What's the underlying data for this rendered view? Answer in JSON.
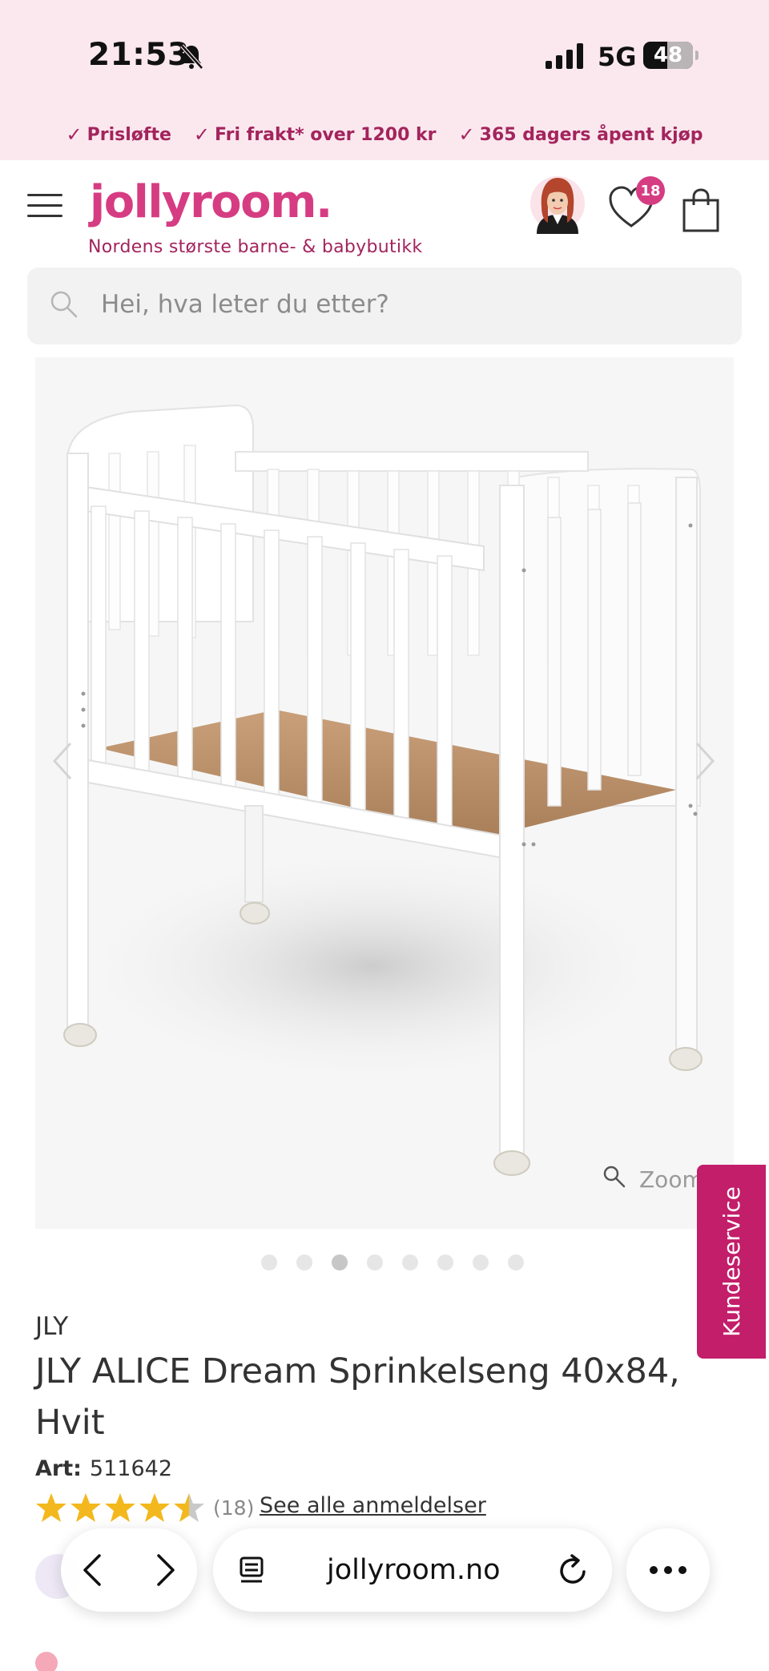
{
  "status_bar": {
    "time": "21:53",
    "network": "5G",
    "battery": "48",
    "icons": [
      "bell-off-icon",
      "signal-icon",
      "battery-icon"
    ]
  },
  "usp": [
    {
      "label": "Prisløfte",
      "icon": "check-icon"
    },
    {
      "label": "Fri frakt* over 1200 kr",
      "icon": "check-icon"
    },
    {
      "label": "365 dagers åpent kjøp",
      "icon": "check-icon"
    }
  ],
  "header": {
    "logo": "jollyroom.",
    "tagline": "Nordens største barne- & babybutikk",
    "wishlist_count": "18",
    "brand_color": "#d63c82"
  },
  "search": {
    "placeholder": "Hei, hva leter du etter?"
  },
  "gallery": {
    "zoom_label": "Zoom",
    "image_count": 8,
    "active_index": 2
  },
  "kundeservice": {
    "label": "Kundeservice",
    "color": "#c21e6a"
  },
  "product": {
    "brand": "JLY",
    "title": "JLY ALICE Dream Sprinkelseng 40x84, Hvit",
    "art_label": "Art:",
    "art_number": "511642",
    "rating": 4.5,
    "rating_max": 5,
    "review_count": "(18)",
    "reviews_link": "See alle anmeldelser"
  },
  "browser": {
    "url": "jollyroom.no"
  }
}
